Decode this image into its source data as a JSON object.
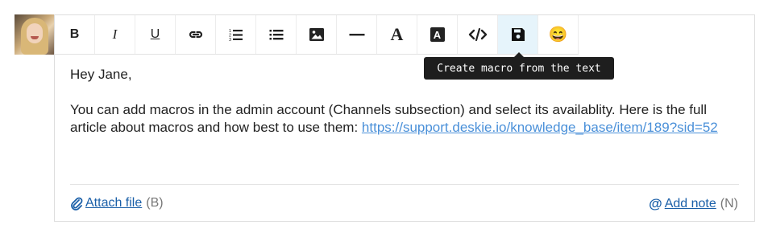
{
  "toolbar": {
    "bold_glyph": "B",
    "italic_glyph": "I",
    "underline_glyph": "U",
    "font_glyph": "A",
    "bgcolor_glyph": "A",
    "emoji_glyph": "😄",
    "items": [
      {
        "name": "bold",
        "icon": "bold-icon"
      },
      {
        "name": "italic",
        "icon": "italic-icon"
      },
      {
        "name": "underline",
        "icon": "underline-icon"
      },
      {
        "name": "link",
        "icon": "link-icon"
      },
      {
        "name": "ordered-list",
        "icon": "ordered-list-icon"
      },
      {
        "name": "bullet-list",
        "icon": "bullet-list-icon"
      },
      {
        "name": "image",
        "icon": "image-icon"
      },
      {
        "name": "horizontal-rule",
        "icon": "horizontal-rule-icon"
      },
      {
        "name": "font",
        "icon": "font-icon"
      },
      {
        "name": "highlight",
        "icon": "highlight-icon"
      },
      {
        "name": "code",
        "icon": "code-icon"
      },
      {
        "name": "save-macro",
        "icon": "save-icon",
        "active": true
      },
      {
        "name": "emoji",
        "icon": "emoji-icon"
      }
    ]
  },
  "tooltip": {
    "text": "Create macro from the text"
  },
  "message": {
    "greeting": "Hey Jane,",
    "body": "You can add macros in the admin account (Channels subsection) and select its availablity. Here is the full article about macros and how best to use them: ",
    "link_text": "https://support.deskie.io/knowledge_base/item/189?sid=52"
  },
  "footer": {
    "attach_label": "Attach file",
    "attach_hint": "(B)",
    "note_prefix": "@",
    "note_label": "Add note",
    "note_hint": "(N)"
  },
  "colors": {
    "accent": "#4a90d9",
    "active_bg": "#e6f4fb",
    "tooltip_bg": "#1e1e1e"
  }
}
